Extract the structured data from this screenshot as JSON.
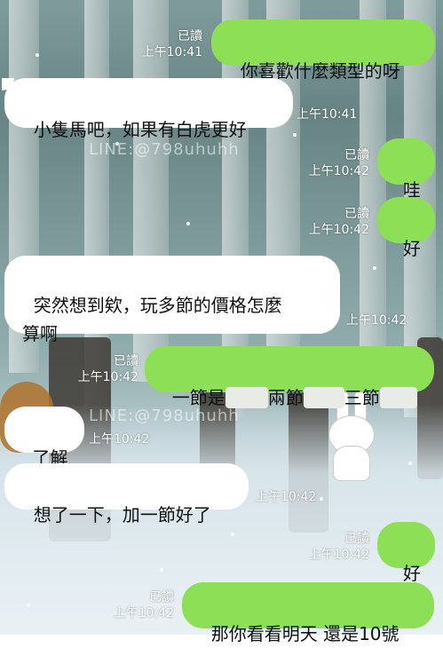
{
  "app": {
    "watermark_text": "LINE:@798uhuhh",
    "colors": {
      "outgoing_bubble": "#8de055",
      "incoming_bubble": "#ffffff",
      "meta_text": "#ffffff"
    }
  },
  "messages": [
    {
      "direction": "out",
      "text": "你喜歡什麼類型的呀",
      "read": "已讀",
      "time": "上午10:41"
    },
    {
      "direction": "in",
      "text": "小隻馬吧，如果有白虎更好",
      "time": "上午10:41"
    },
    {
      "direction": "out",
      "text": "哇",
      "read": "已讀",
      "time": "上午10:42"
    },
    {
      "direction": "out",
      "text": "好",
      "read": "已讀",
      "time": "上午10:42"
    },
    {
      "direction": "in",
      "text": "突然想到欸，玩多節的價格怎麼\n算啊",
      "time": "上午10:42"
    },
    {
      "direction": "out",
      "parts": [
        "一節是",
        "兩節",
        "三節"
      ],
      "read": "已讀",
      "time": "上午10:42"
    },
    {
      "direction": "in",
      "text": "了解",
      "time": "上午10:42"
    },
    {
      "direction": "in",
      "text": "想了一下，加一節好了",
      "time": "上午10:42"
    },
    {
      "direction": "out",
      "text": "好",
      "read": "已讀",
      "time": "上午10:42"
    },
    {
      "direction": "out",
      "text": "那你看看明天 還是10號",
      "read": "已讀",
      "time": "上午10:42"
    }
  ]
}
